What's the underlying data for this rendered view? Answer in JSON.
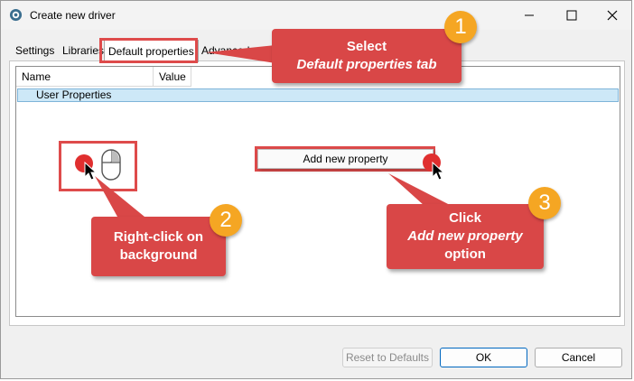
{
  "window": {
    "title": "Create new driver"
  },
  "tabs": [
    {
      "label": "Settings"
    },
    {
      "label": "Libraries"
    },
    {
      "label": "Default properties"
    },
    {
      "label": "Advanced"
    }
  ],
  "grid": {
    "columns": [
      "Name",
      "Value"
    ],
    "rows": [
      {
        "name": "User Properties"
      }
    ]
  },
  "context_menu": {
    "item": "Add new property"
  },
  "buttons": {
    "reset": "Reset to Defaults",
    "ok": "OK",
    "cancel": "Cancel"
  },
  "callouts": [
    {
      "number": "1",
      "line1": "Select",
      "line2": "Default properties tab"
    },
    {
      "number": "2",
      "line1": "Right-click on",
      "line2": "background"
    },
    {
      "number": "3",
      "line1": "Click",
      "line2": "Add new property",
      "line3": "option"
    }
  ],
  "colors": {
    "callout": "#d94747",
    "badge": "#f5a623",
    "selection": "#cde8f7",
    "highlight": "#de4b4b"
  }
}
